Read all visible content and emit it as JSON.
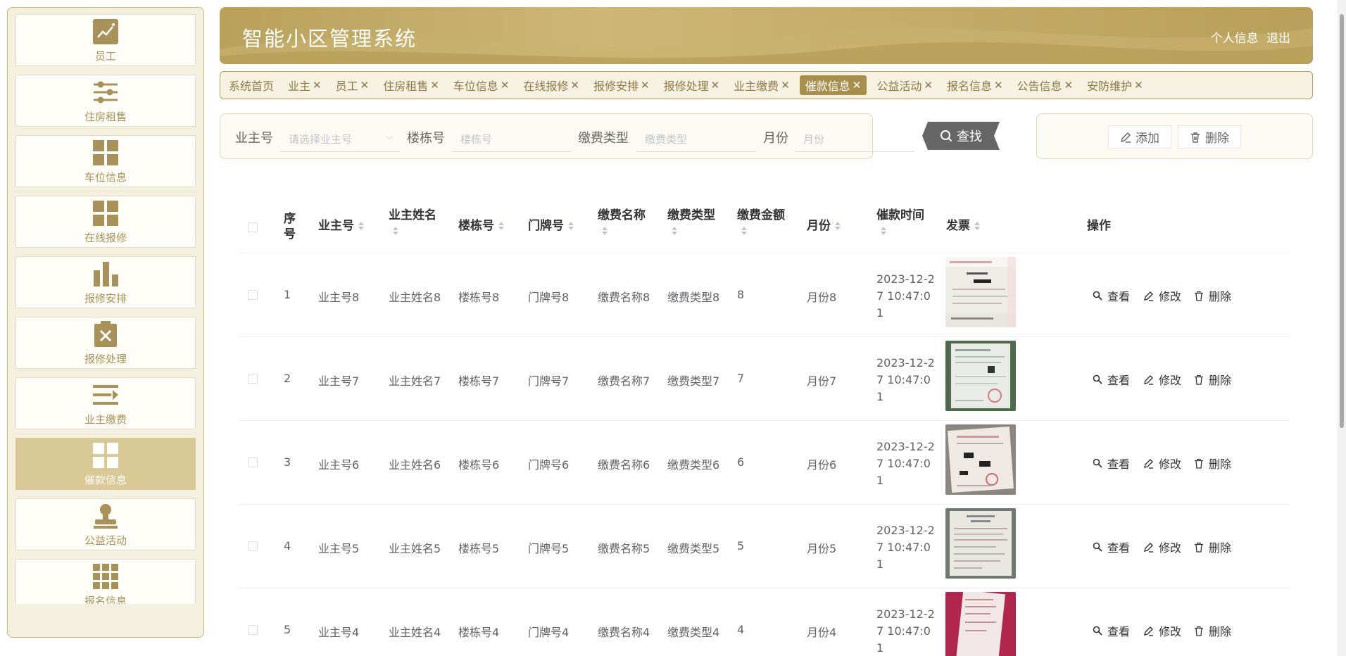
{
  "header": {
    "title": "智能小区管理系统",
    "profile_link": "个人信息",
    "logout_link": "退出"
  },
  "sidebar": {
    "items": [
      {
        "label": "员工",
        "icon": "chart-line-icon"
      },
      {
        "label": "住房租售",
        "icon": "sliders-icon"
      },
      {
        "label": "车位信息",
        "icon": "grid-icon"
      },
      {
        "label": "在线报修",
        "icon": "grid-icon"
      },
      {
        "label": "报修安排",
        "icon": "bar-chart-icon"
      },
      {
        "label": "报修处理",
        "icon": "clipboard-x-icon"
      },
      {
        "label": "业主缴费",
        "icon": "list-arrow-icon"
      },
      {
        "label": "催款信息",
        "icon": "grid-icon",
        "active": true
      },
      {
        "label": "公益活动",
        "icon": "stamp-icon"
      },
      {
        "label": "报名信息",
        "icon": "grid-nine-icon"
      }
    ]
  },
  "tags": {
    "home": "系统首页",
    "items": [
      "业主",
      "员工",
      "住房租售",
      "车位信息",
      "在线报修",
      "报修安排",
      "报修处理",
      "业主缴费",
      "催款信息",
      "公益活动",
      "报名信息",
      "公告信息",
      "安防维护"
    ],
    "active": "催款信息",
    "close_glyph": "✕"
  },
  "search": {
    "owner_no_label": "业主号",
    "owner_no_placeholder": "请选择业主号",
    "building_label": "楼栋号",
    "building_placeholder": "楼栋号",
    "fee_type_label": "缴费类型",
    "fee_type_placeholder": "缴费类型",
    "month_label": "月份",
    "month_placeholder": "月份",
    "search_button": "查找"
  },
  "actions": {
    "add_button": "添加",
    "delete_button": "删除"
  },
  "table": {
    "columns": {
      "index_a": "序",
      "index_b": "号",
      "owner_no": "业主号",
      "owner_name": "业主姓名",
      "building": "楼栋号",
      "door": "门牌号",
      "fee_name": "缴费名称",
      "fee_type": "缴费类型",
      "amount": "缴费金额",
      "month": "月份",
      "remind_time": "催款时间",
      "invoice": "发票",
      "ops": "操作"
    },
    "op_labels": {
      "view": "查看",
      "edit": "修改",
      "delete": "删除"
    },
    "rows": [
      {
        "index": "1",
        "owner_no": "业主号8",
        "owner_name": "业主姓名8",
        "building": "楼栋号8",
        "door": "门牌号8",
        "fee_name": "缴费名称8",
        "fee_type": "缴费类型8",
        "amount": "8",
        "month": "月份8",
        "time": "2023-12-27 10:47:01"
      },
      {
        "index": "2",
        "owner_no": "业主号7",
        "owner_name": "业主姓名7",
        "building": "楼栋号7",
        "door": "门牌号7",
        "fee_name": "缴费名称7",
        "fee_type": "缴费类型7",
        "amount": "7",
        "month": "月份7",
        "time": "2023-12-27 10:47:01"
      },
      {
        "index": "3",
        "owner_no": "业主号6",
        "owner_name": "业主姓名6",
        "building": "楼栋号6",
        "door": "门牌号6",
        "fee_name": "缴费名称6",
        "fee_type": "缴费类型6",
        "amount": "6",
        "month": "月份6",
        "time": "2023-12-27 10:47:01"
      },
      {
        "index": "4",
        "owner_no": "业主号5",
        "owner_name": "业主姓名5",
        "building": "楼栋号5",
        "door": "门牌号5",
        "fee_name": "缴费名称5",
        "fee_type": "缴费类型5",
        "amount": "5",
        "month": "月份5",
        "time": "2023-12-27 10:47:01"
      },
      {
        "index": "5",
        "owner_no": "业主号4",
        "owner_name": "业主姓名4",
        "building": "楼栋号4",
        "door": "门牌号4",
        "fee_name": "缴费名称4",
        "fee_type": "缴费类型4",
        "amount": "4",
        "month": "月份4",
        "time": "2023-12-27 10:47:01"
      }
    ]
  },
  "colors": {
    "brand": "#b9a15a",
    "sidebar_active": "#d9c995",
    "tag_active": "#a88f4c",
    "search_button": "#666666"
  }
}
